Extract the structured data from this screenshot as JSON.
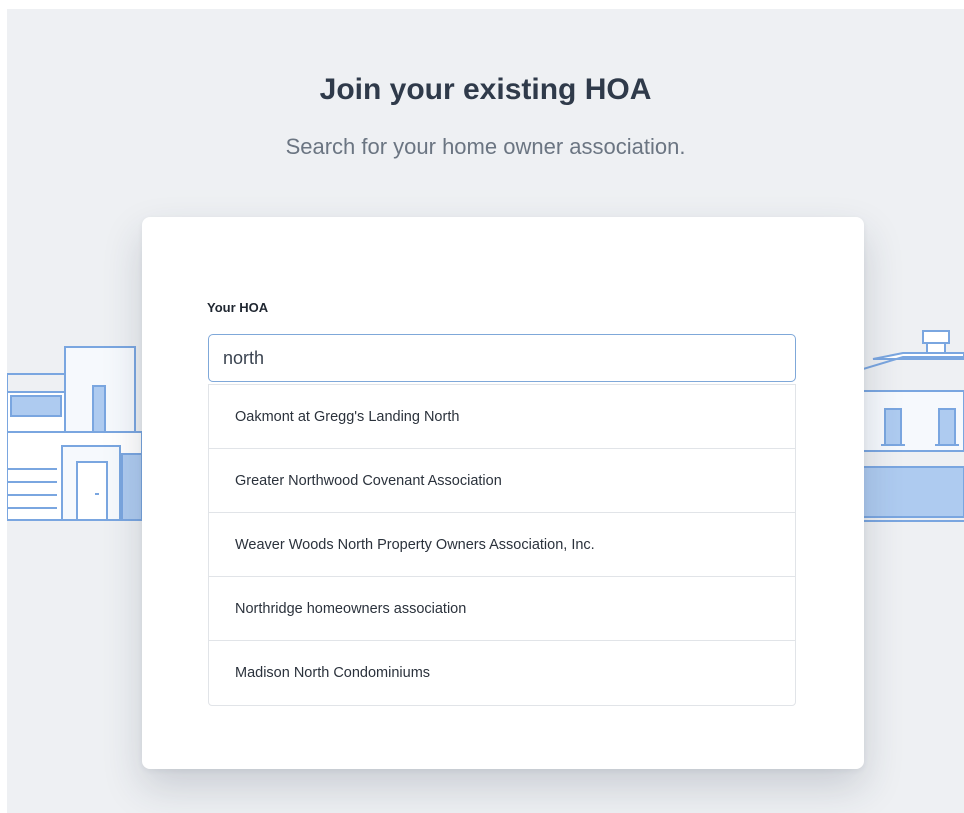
{
  "header": {
    "title": "Join your existing HOA",
    "subtitle": "Search for your home owner association."
  },
  "form": {
    "label": "Your HOA",
    "search_value": "north"
  },
  "suggestions": [
    "Oakmont at Gregg's Landing North",
    "Greater Northwood Covenant Association",
    "Weaver Woods North Property Owners Association, Inc.",
    "Northridge homeowners association",
    "Madison North Condominiums"
  ],
  "colors": {
    "background": "#eef0f3",
    "card": "#ffffff",
    "input_border": "#7fa8d9",
    "illustration_stroke": "#7aa6e0"
  }
}
